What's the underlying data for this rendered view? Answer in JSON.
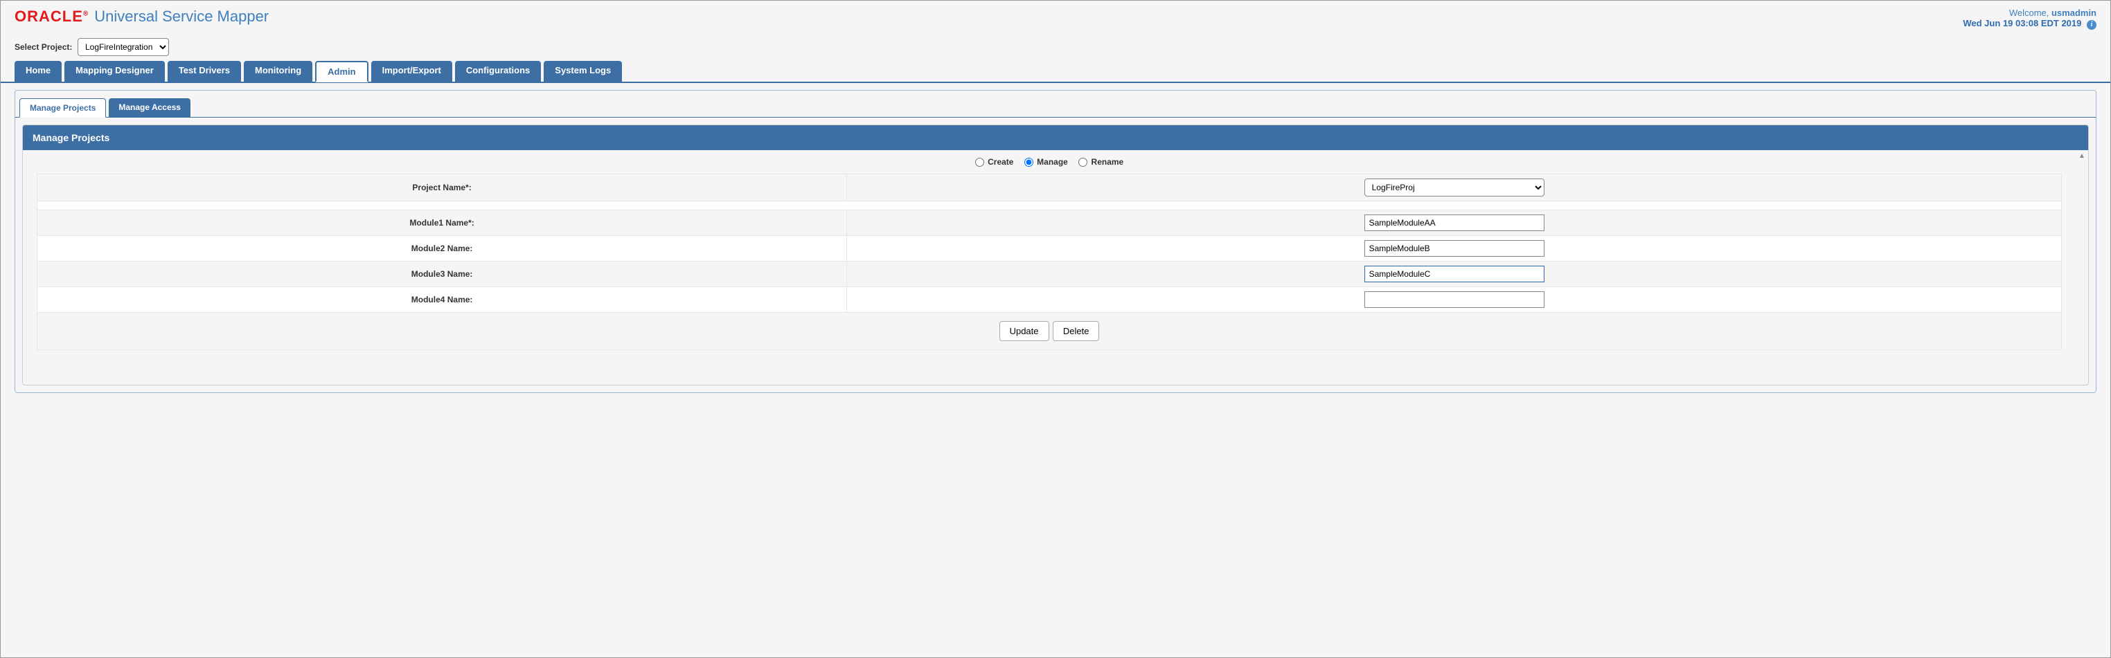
{
  "header": {
    "logo_text": "ORACLE",
    "logo_sup": "®",
    "app_title": "Universal Service Mapper",
    "welcome_prefix": "Welcome, ",
    "welcome_user": "usmadmin",
    "datetime": "Wed Jun 19 03:08 EDT 2019"
  },
  "project": {
    "label": "Select Project:",
    "selected": "LogFireIntegration"
  },
  "tabs": {
    "home": "Home",
    "mapping_designer": "Mapping Designer",
    "test_drivers": "Test Drivers",
    "monitoring": "Monitoring",
    "admin": "Admin",
    "import_export": "Import/Export",
    "configurations": "Configurations",
    "system_logs": "System Logs"
  },
  "sub_tabs": {
    "manage_projects": "Manage Projects",
    "manage_access": "Manage Access"
  },
  "panel": {
    "heading": "Manage Projects",
    "radios": {
      "create": "Create",
      "manage": "Manage",
      "rename": "Rename"
    },
    "rows": {
      "project_name_label": "Project Name*:",
      "project_name_value": "LogFireProj",
      "module1_label": "Module1 Name*:",
      "module1_value": "SampleModuleAA",
      "module2_label": "Module2 Name:",
      "module2_value": "SampleModuleB",
      "module3_label": "Module3 Name:",
      "module3_value": "SampleModuleC",
      "module4_label": "Module4 Name:",
      "module4_value": ""
    },
    "buttons": {
      "update": "Update",
      "delete": "Delete"
    }
  }
}
